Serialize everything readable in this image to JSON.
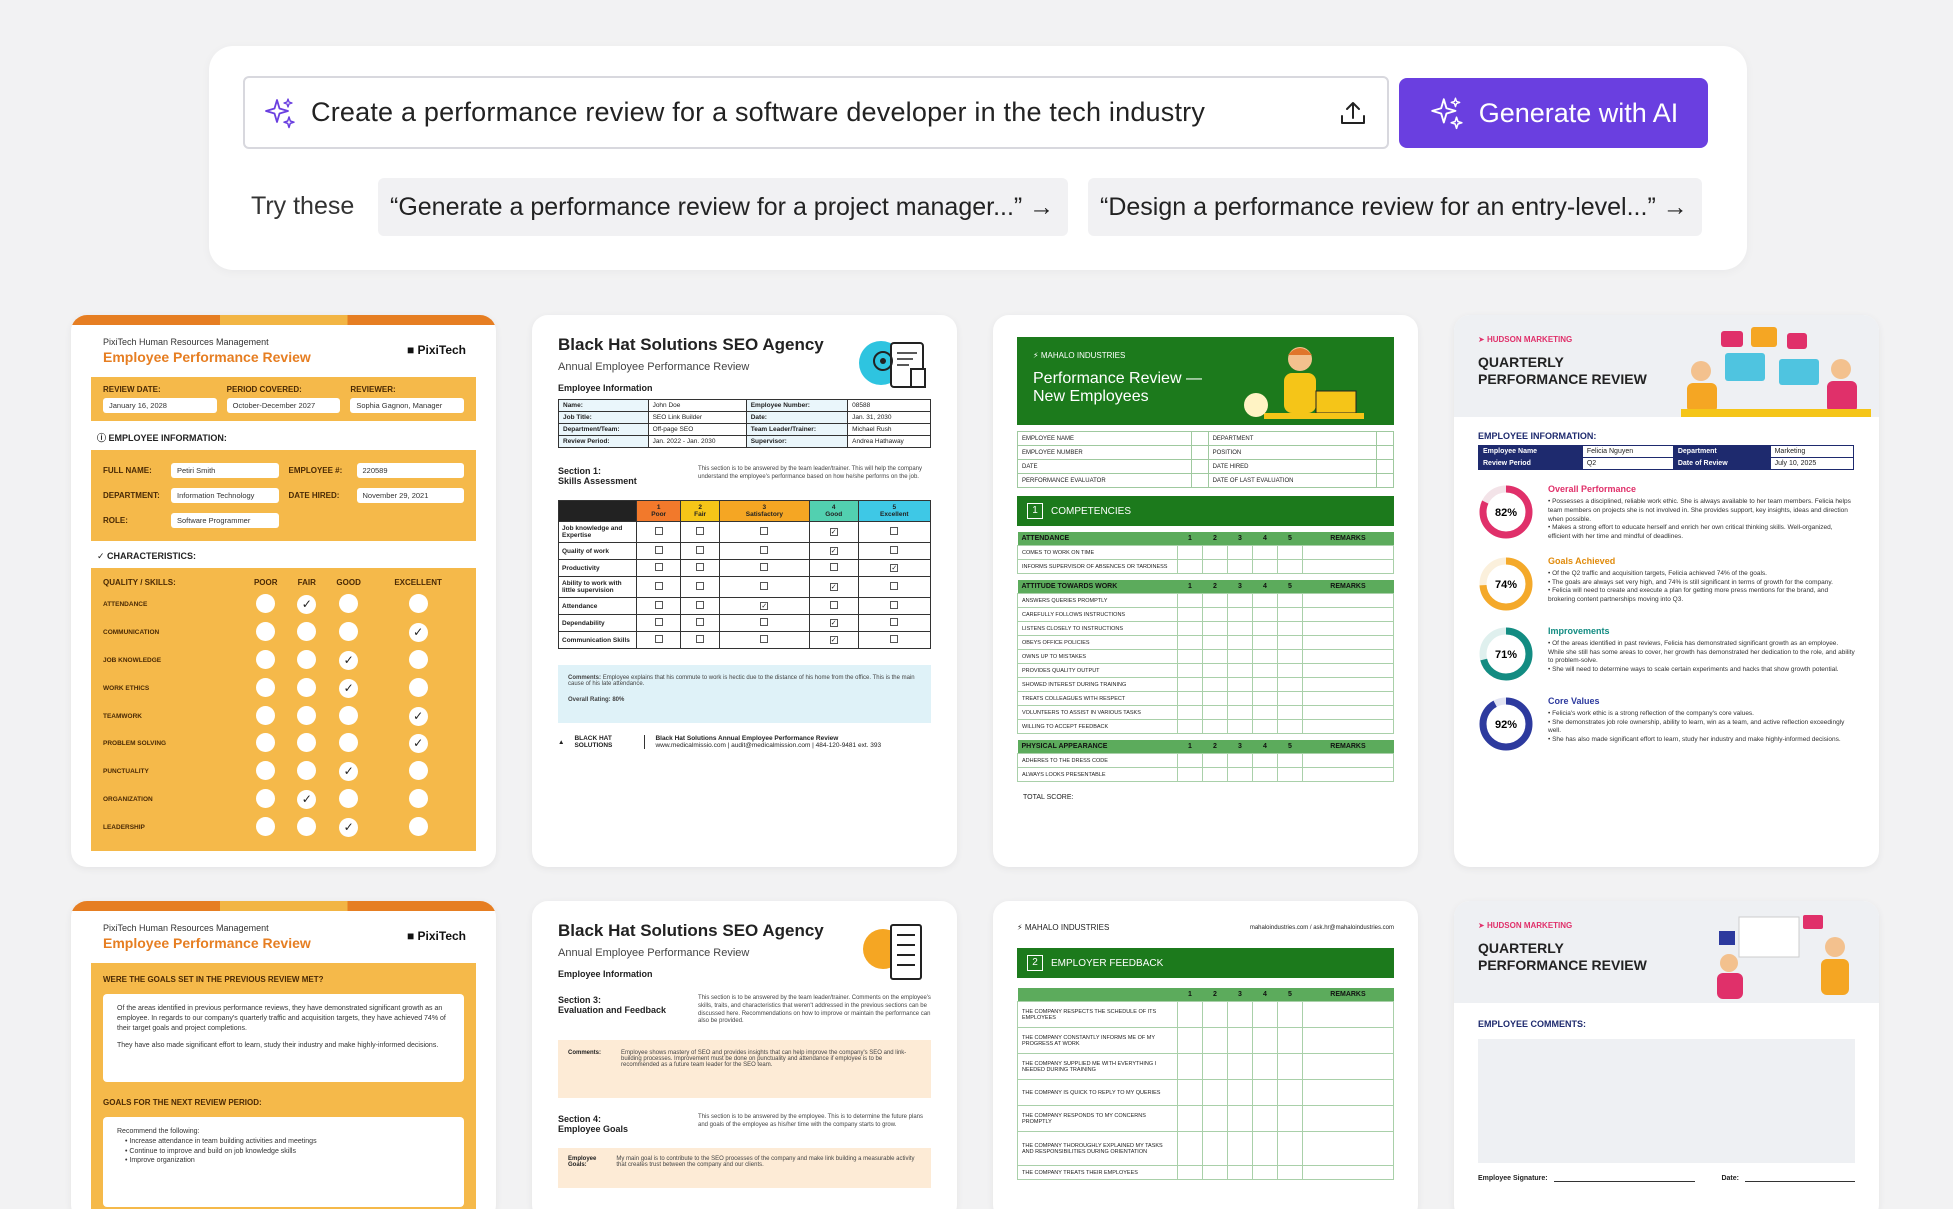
{
  "prompt": {
    "text": "Create a performance review for a software developer in the tech industry",
    "generate_label": "Generate with AI",
    "try_label": "Try these",
    "suggestions": [
      "“Generate a performance review for a project manager...” →",
      "“Design a performance review for an entry-level...” →"
    ]
  },
  "pixi1": {
    "sub": "PixiTech Human Resources Management",
    "title": "Employee Performance Review",
    "logo": "PixiTech",
    "review_date_label": "REVIEW DATE:",
    "review_date": "January 16, 2028",
    "period_label": "PERIOD COVERED:",
    "period": "October-December 2027",
    "reviewer_label": "REVIEWER:",
    "reviewer": "Sophia Gagnon, Manager",
    "emp_info": "EMPLOYEE INFORMATION:",
    "full_name_label": "FULL NAME:",
    "full_name": "Petiri Smith",
    "emp_no_label": "EMPLOYEE #:",
    "emp_no": "220589",
    "dept_label": "DEPARTMENT:",
    "dept": "Information Technology",
    "hired_label": "DATE HIRED:",
    "hired": "November 29, 2021",
    "role_label": "ROLE:",
    "role": "Software Programmer",
    "characteristics": "CHARACTERISTICS:",
    "cols": [
      "QUALITY / SKILLS:",
      "POOR",
      "FAIR",
      "GOOD",
      "EXCELLENT"
    ],
    "skills": [
      "ATTENDANCE",
      "COMMUNICATION",
      "JOB KNOWLEDGE",
      "WORK ETHICS",
      "TEAMWORK",
      "PROBLEM SOLVING",
      "PUNCTUALITY",
      "ORGANIZATION",
      "LEADERSHIP"
    ]
  },
  "bh1": {
    "title": "Black Hat Solutions SEO Agency",
    "sub": "Annual Employee Performance Review",
    "emp_info": "Employee Information",
    "name_k": "Name:",
    "name_v": "John Doe",
    "empno_k": "Employee Number:",
    "empno_v": "08588",
    "job_k": "Job Title:",
    "job_v": "SEO Link Builder",
    "date_k": "Date:",
    "date_v": "Jan. 31, 2030",
    "dept_k": "Department/Team:",
    "dept_v": "Off-page SEO",
    "lead_k": "Team Leader/Trainer:",
    "lead_v": "Michael Rush",
    "period_k": "Review Period:",
    "period_v": "Jan. 2022 - Jan. 2030",
    "sup_k": "Supervisor:",
    "sup_v": "Andrea Hathaway",
    "section": "Section 1:\nSkills Assessment",
    "section_note": "This section is to be answered by the team leader/trainer. This will help the company understand the employee's performance based on how he/she performs on the job.",
    "rating_heads": [
      "1\nPoor",
      "2\nFair",
      "3\nSatisfactory",
      "4\nGood",
      "5\nExcellent"
    ],
    "rows": [
      "Job knowledge and Expertise",
      "Quality of work",
      "Productivity",
      "Ability to work with little supervision",
      "Attendance",
      "Dependability",
      "Communication Skills"
    ],
    "comments_label": "Comments:",
    "comments": "Employee explains that his commute to work is hectic due to the distance of his home from the office. This is the main cause of his late attendance.",
    "overall": "Overall Rating: 80%",
    "footer_co": "BLACK HAT SOLUTIONS",
    "footer_t": "Black Hat Solutions Annual Employee Performance Review",
    "footer_c": "www.medicalmissio.com | audit@medicalmission.com | 484-120-9481 ext. 393"
  },
  "mh1": {
    "co": "MAHALO INDUSTRIES",
    "title": "Performance Review — New Employees",
    "fields": [
      [
        "EMPLOYEE NAME",
        "DEPARTMENT"
      ],
      [
        "EMPLOYEE NUMBER",
        "POSITION"
      ],
      [
        "DATE",
        "DATE HIRED"
      ],
      [
        "PERFORMANCE EVALUATOR",
        "DATE OF LAST EVALUATION"
      ]
    ],
    "comp_no": "1",
    "comp": "COMPETENCIES",
    "groups": [
      {
        "name": "ATTENDANCE",
        "rows": [
          "COMES TO WORK ON TIME",
          "INFORMS SUPERVISOR OF ABSENCES OR TARDINESS"
        ]
      },
      {
        "name": "ATTITUDE TOWARDS WORK",
        "rows": [
          "ANSWERS QUERIES PROMPTLY",
          "CAREFULLY FOLLOWS INSTRUCTIONS",
          "LISTENS CLOSELY TO INSTRUCTIONS",
          "OBEYS OFFICE POLICIES",
          "OWNS UP TO MISTAKES",
          "PROVIDES QUALITY OUTPUT",
          "SHOWED INTEREST DURING TRAINING",
          "TREATS COLLEAGUES WITH RESPECT",
          "VOLUNTEERS TO ASSIST IN VARIOUS TASKS",
          "WILLING TO ACCEPT FEEDBACK"
        ]
      },
      {
        "name": "PHYSICAL APPEARANCE",
        "rows": [
          "ADHERES TO THE DRESS CODE",
          "ALWAYS LOOKS PRESENTABLE"
        ]
      }
    ],
    "score_cols": [
      "1",
      "2",
      "3",
      "4",
      "5",
      "REMARKS"
    ],
    "total": "TOTAL SCORE:"
  },
  "hd1": {
    "co": "HUDSON MARKETING",
    "title": "QUARTERLY\nPERFORMANCE REVIEW",
    "emp_info": "EMPLOYEE INFORMATION:",
    "name_k": "Employee Name",
    "name_v": "Felicia Nguyen",
    "dept_k": "Department",
    "dept_v": "Marketing",
    "period_k": "Review Period",
    "period_v": "Q2",
    "date_k": "Date of Review",
    "date_v": "July 10, 2025",
    "items": [
      {
        "pct": "82%",
        "value": 82,
        "color": "#e0306a",
        "head": "Overall Performance",
        "head_color": "#e0306a",
        "body": "• Possesses a disciplined, reliable work ethic. She is always available to her team members. Felicia helps team members on projects she is not involved in. She provides support, key insights, ideas and direction when possible.\n• Makes a strong effort to educate herself and enrich her own critical thinking skills. Well-organized, efficient with her time and mindful of deadlines."
      },
      {
        "pct": "74%",
        "value": 74,
        "color": "#f4a92a",
        "head": "Goals Achieved",
        "head_color": "#e08a0a",
        "body": "• Of the Q2 traffic and acquisition targets, Felicia achieved 74% of the goals.\n• The goals are always set very high, and 74% is still significant in terms of growth for the company.\n• Felicia will need to create and execute a plan for getting more press mentions for the brand, and brokering content partnerships moving into Q3."
      },
      {
        "pct": "71%",
        "value": 71,
        "color": "#138c82",
        "head": "Improvements",
        "head_color": "#138c82",
        "body": "• Of the areas identified in past reviews, Felicia has demonstrated significant growth as an employee. While she still has some areas to cover, her growth has demonstrated her dedication to the role, and ability to problem-solve.\n• She will need to determine ways to scale certain experiments and hacks that show growth potential."
      },
      {
        "pct": "92%",
        "value": 92,
        "color": "#2d3a9e",
        "head": "Core Values",
        "head_color": "#2d3a9e",
        "body": "• Felicia's work ethic is a strong reflection of the company's core values.\n• She demonstrates job role ownership, ability to learn, win as a team, and active reflection exceedingly well.\n• She has also made significant effort to learn, study her industry and make highly-informed decisions."
      }
    ]
  },
  "pixi2": {
    "sub": "PixiTech Human Resources Management",
    "title": "Employee Performance Review",
    "logo": "PixiTech",
    "q1": "WERE THE GOALS SET IN THE PREVIOUS REVIEW MET?",
    "a1": "Of the areas identified in previous performance reviews, they have demonstrated significant growth as an employee. In regards to our company's quarterly traffic and acquisition targets, they have achieved 74% of their target goals and project completions.",
    "a1b": "They have also made significant effort to learn, study their industry and make highly-informed decisions.",
    "q2": "GOALS FOR THE NEXT REVIEW PERIOD:",
    "a2": "Recommend the following:",
    "a2_items": [
      "Increase attendance in team building activities and meetings",
      "Continue to improve and build on job knowledge skills",
      "Improve organization"
    ]
  },
  "bh2": {
    "title": "Black Hat Solutions SEO Agency",
    "sub": "Annual Employee Performance Review",
    "emp_info": "Employee Information",
    "s3": "Section 3:\nEvaluation and Feedback",
    "s3_note": "This section is to be answered by the team leader/trainer. Comments on the employee's skills, traits, and characteristics that weren't addressed in the previous sections can be discussed here. Recommendations on how to improve or maintain the performance can also be provided.",
    "comments_label": "Comments:",
    "comments": "Employee shows mastery of SEO and provides insights that can help improve the company's SEO and link-building processes. Improvement must be done on punctuality and attendance if employee is to be recommended as a future team leader for the SEO team.",
    "s4": "Section 4:\nEmployee Goals",
    "s4_note": "This section is to be answered by the employee. This is to determine the future plans and goals of the employee as his/her time with the company starts to grow.",
    "goals_label": "Employee Goals:",
    "goals": "My main goal is to contribute to the SEO processes of the company and make link building a measurable activity that creates trust between the company and our clients."
  },
  "mh2": {
    "co": "MAHALO INDUSTRIES",
    "contact": "mahaloindustries.com / ask.hr@mahaloindustries.com",
    "sec_no": "2",
    "sec": "EMPLOYER FEEDBACK",
    "score_cols": [
      "1",
      "2",
      "3",
      "4",
      "5",
      "REMARKS"
    ],
    "rows": [
      "THE COMPANY RESPECTS THE SCHEDULE OF ITS EMPLOYEES",
      "THE COMPANY CONSTANTLY INFORMS ME OF MY PROGRESS AT WORK",
      "THE COMPANY SUPPLIED ME WITH EVERYTHING I NEEDED DURING TRAINING",
      "THE COMPANY IS QUICK TO REPLY TO MY QUERIES",
      "THE COMPANY RESPONDS TO MY CONCERNS PROMPTLY",
      "THE COMPANY THOROUGHLY EXPLAINED MY TASKS AND RESPONSIBILITIES DURING ORIENTATION",
      "THE COMPANY TREATS THEIR EMPLOYEES"
    ]
  },
  "hd2": {
    "co": "HUDSON MARKETING",
    "title": "QUARTERLY\nPERFORMANCE REVIEW",
    "comments": "EMPLOYEE COMMENTS:",
    "signature": "Employee Signature:",
    "date": "Date:"
  }
}
